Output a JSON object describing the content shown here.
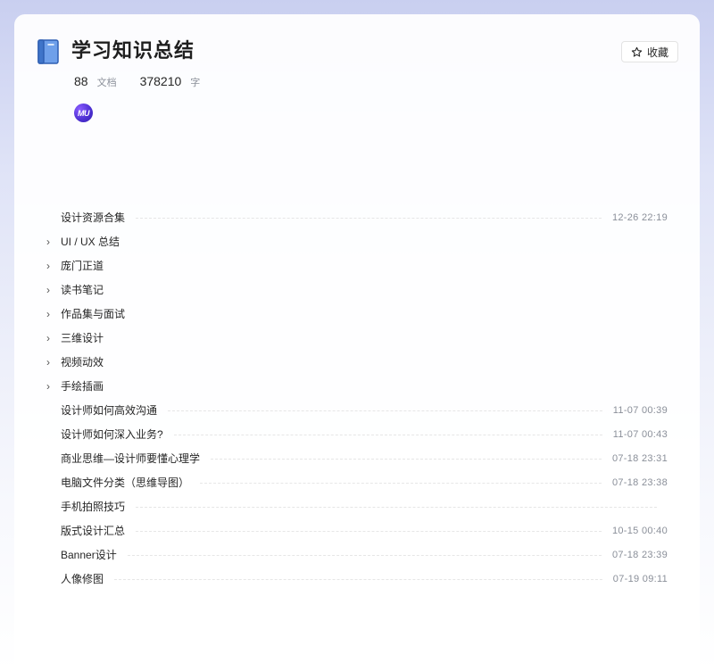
{
  "book": {
    "title": "学习知识总结",
    "favorite_label": "收藏",
    "doc_count": "88",
    "doc_unit": "文档",
    "word_count": "378210",
    "word_unit": "字",
    "author_avatar_text": "MU"
  },
  "icons": {
    "book": "book-icon",
    "favorite": "star-icon",
    "expand": "chevron-right-icon"
  },
  "colors": {
    "book_icon_fill": "#5b8fe0",
    "book_icon_stroke": "#2f5fb3",
    "avatar": "#5a36e0"
  },
  "toc": [
    {
      "title": "设计资源合集",
      "date": "12-26 22:19",
      "expandable": false
    },
    {
      "title": "UI / UX 总结",
      "date": "",
      "expandable": true
    },
    {
      "title": "庞门正道",
      "date": "",
      "expandable": true
    },
    {
      "title": "读书笔记",
      "date": "",
      "expandable": true
    },
    {
      "title": "作品集与面试",
      "date": "",
      "expandable": true
    },
    {
      "title": "三维设计",
      "date": "",
      "expandable": true
    },
    {
      "title": "视频动效",
      "date": "",
      "expandable": true
    },
    {
      "title": "手绘插画",
      "date": "",
      "expandable": true
    },
    {
      "title": "设计师如何高效沟通",
      "date": "11-07 00:39",
      "expandable": false
    },
    {
      "title": "设计师如何深入业务?",
      "date": "11-07 00:43",
      "expandable": false
    },
    {
      "title": "商业思维—设计师要懂心理学",
      "date": "07-18 23:31",
      "expandable": false
    },
    {
      "title": "电脑文件分类（思维导图）",
      "date": "07-18 23:38",
      "expandable": false
    },
    {
      "title": "手机拍照技巧",
      "date": "",
      "expandable": false,
      "leader": true
    },
    {
      "title": "版式设计汇总",
      "date": "10-15 00:40",
      "expandable": false
    },
    {
      "title": "Banner设计",
      "date": "07-18 23:39",
      "expandable": false
    },
    {
      "title": "人像修图",
      "date": "07-19 09:11",
      "expandable": false
    }
  ]
}
